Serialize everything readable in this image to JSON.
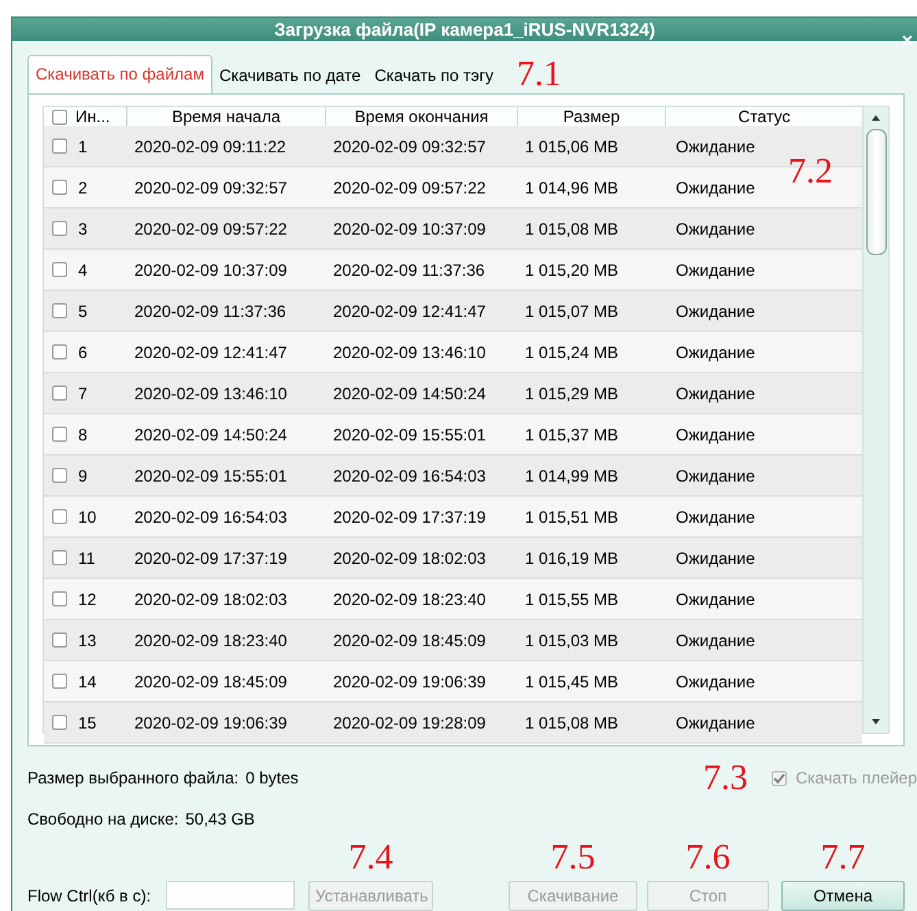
{
  "window": {
    "title": "Загрузка файла(IP камера1_iRUS-NVR1324)",
    "close": "×"
  },
  "tabs": [
    {
      "label": "Скачивать по файлам",
      "selected": true
    },
    {
      "label": "Скачивать по дате",
      "selected": false
    },
    {
      "label": "Скачать по тэгу",
      "selected": false
    }
  ],
  "tabs_annotation": "7.1",
  "table": {
    "select_all_checked": false,
    "columns": [
      "Ин...",
      "Время начала",
      "Время окончания",
      "Размер",
      "Статус"
    ],
    "annotation": "7.2",
    "rows": [
      {
        "checked": false,
        "cells": [
          "1",
          "2020-02-09 09:11:22",
          "2020-02-09 09:32:57",
          "1 015,06 MB",
          "Ожидание"
        ]
      },
      {
        "checked": false,
        "cells": [
          "2",
          "2020-02-09 09:32:57",
          "2020-02-09 09:57:22",
          "1 014,96 MB",
          "Ожидание"
        ]
      },
      {
        "checked": false,
        "cells": [
          "3",
          "2020-02-09 09:57:22",
          "2020-02-09 10:37:09",
          "1 015,08 MB",
          "Ожидание"
        ]
      },
      {
        "checked": false,
        "cells": [
          "4",
          "2020-02-09 10:37:09",
          "2020-02-09 11:37:36",
          "1 015,20 MB",
          "Ожидание"
        ]
      },
      {
        "checked": false,
        "cells": [
          "5",
          "2020-02-09 11:37:36",
          "2020-02-09 12:41:47",
          "1 015,07 MB",
          "Ожидание"
        ]
      },
      {
        "checked": false,
        "cells": [
          "6",
          "2020-02-09 12:41:47",
          "2020-02-09 13:46:10",
          "1 015,24 MB",
          "Ожидание"
        ]
      },
      {
        "checked": false,
        "cells": [
          "7",
          "2020-02-09 13:46:10",
          "2020-02-09 14:50:24",
          "1 015,29 MB",
          "Ожидание"
        ]
      },
      {
        "checked": false,
        "cells": [
          "8",
          "2020-02-09 14:50:24",
          "2020-02-09 15:55:01",
          "1 015,37 MB",
          "Ожидание"
        ]
      },
      {
        "checked": false,
        "cells": [
          "9",
          "2020-02-09 15:55:01",
          "2020-02-09 16:54:03",
          "1 014,99 MB",
          "Ожидание"
        ]
      },
      {
        "checked": false,
        "cells": [
          "10",
          "2020-02-09 16:54:03",
          "2020-02-09 17:37:19",
          "1 015,51 MB",
          "Ожидание"
        ]
      },
      {
        "checked": false,
        "cells": [
          "11",
          "2020-02-09 17:37:19",
          "2020-02-09 18:02:03",
          "1 016,19 MB",
          "Ожидание"
        ]
      },
      {
        "checked": false,
        "cells": [
          "12",
          "2020-02-09 18:02:03",
          "2020-02-09 18:23:40",
          "1 015,55 MB",
          "Ожидание"
        ]
      },
      {
        "checked": false,
        "cells": [
          "13",
          "2020-02-09 18:23:40",
          "2020-02-09 18:45:09",
          "1 015,03 MB",
          "Ожидание"
        ]
      },
      {
        "checked": false,
        "cells": [
          "14",
          "2020-02-09 18:45:09",
          "2020-02-09 19:06:39",
          "1 015,45 MB",
          "Ожидание"
        ]
      },
      {
        "checked": false,
        "cells": [
          "15",
          "2020-02-09 19:06:39",
          "2020-02-09 19:28:09",
          "1 015,08 MB",
          "Ожидание"
        ]
      }
    ]
  },
  "selected_size": {
    "label": "Размер выбранного файла:",
    "value": "0 bytes"
  },
  "download_player": {
    "annotation": "7.3",
    "label": "Скачать плейер",
    "checked": true,
    "disabled": true
  },
  "free_space": {
    "label": "Свободно на диске:",
    "value": "50,43 GB"
  },
  "flow_ctrl": {
    "label": "Flow Ctrl(кб в с):"
  },
  "buttons": [
    {
      "label": "Устанавливать",
      "annotation": "7.4",
      "disabled": true
    },
    {
      "label": "Скачивание",
      "annotation": "7.5",
      "disabled": true
    },
    {
      "label": "Стоп",
      "annotation": "7.6",
      "disabled": true
    },
    {
      "label": "Отмена",
      "annotation": "7.7",
      "disabled": false
    }
  ]
}
